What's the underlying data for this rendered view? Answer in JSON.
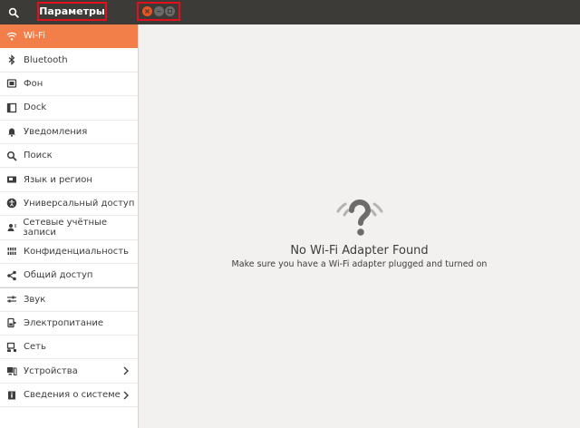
{
  "window": {
    "title": "Параметры"
  },
  "sidebar": {
    "items": [
      {
        "label": "Wi-Fi",
        "icon": "wifi-icon"
      },
      {
        "label": "Bluetooth",
        "icon": "bluetooth-icon"
      },
      {
        "label": "Фон",
        "icon": "background-icon"
      },
      {
        "label": "Dock",
        "icon": "dock-icon"
      },
      {
        "label": "Уведомления",
        "icon": "notifications-icon"
      },
      {
        "label": "Поиск",
        "icon": "search-icon"
      },
      {
        "label": "Язык и регион",
        "icon": "language-flag-icon"
      },
      {
        "label": "Универсальный доступ",
        "icon": "accessibility-icon"
      },
      {
        "label": "Сетевые учётные записи",
        "icon": "online-accounts-icon"
      },
      {
        "label": "Конфиденциальность",
        "icon": "privacy-icon"
      },
      {
        "label": "Общий доступ",
        "icon": "share-icon"
      },
      {
        "label": "Звук",
        "icon": "sound-icon"
      },
      {
        "label": "Электропитание",
        "icon": "power-icon"
      },
      {
        "label": "Сеть",
        "icon": "network-icon"
      },
      {
        "label": "Устройства",
        "icon": "devices-icon"
      },
      {
        "label": "Сведения о системе",
        "icon": "info-icon"
      }
    ]
  },
  "main": {
    "empty_title": "No Wi-Fi Adapter Found",
    "empty_desc": "Make sure you have a Wi-Fi adapter plugged and turned on"
  },
  "colors": {
    "accent": "#f27f4a",
    "titlebar": "#3c3b37",
    "highlight_border": "#e0101c"
  }
}
